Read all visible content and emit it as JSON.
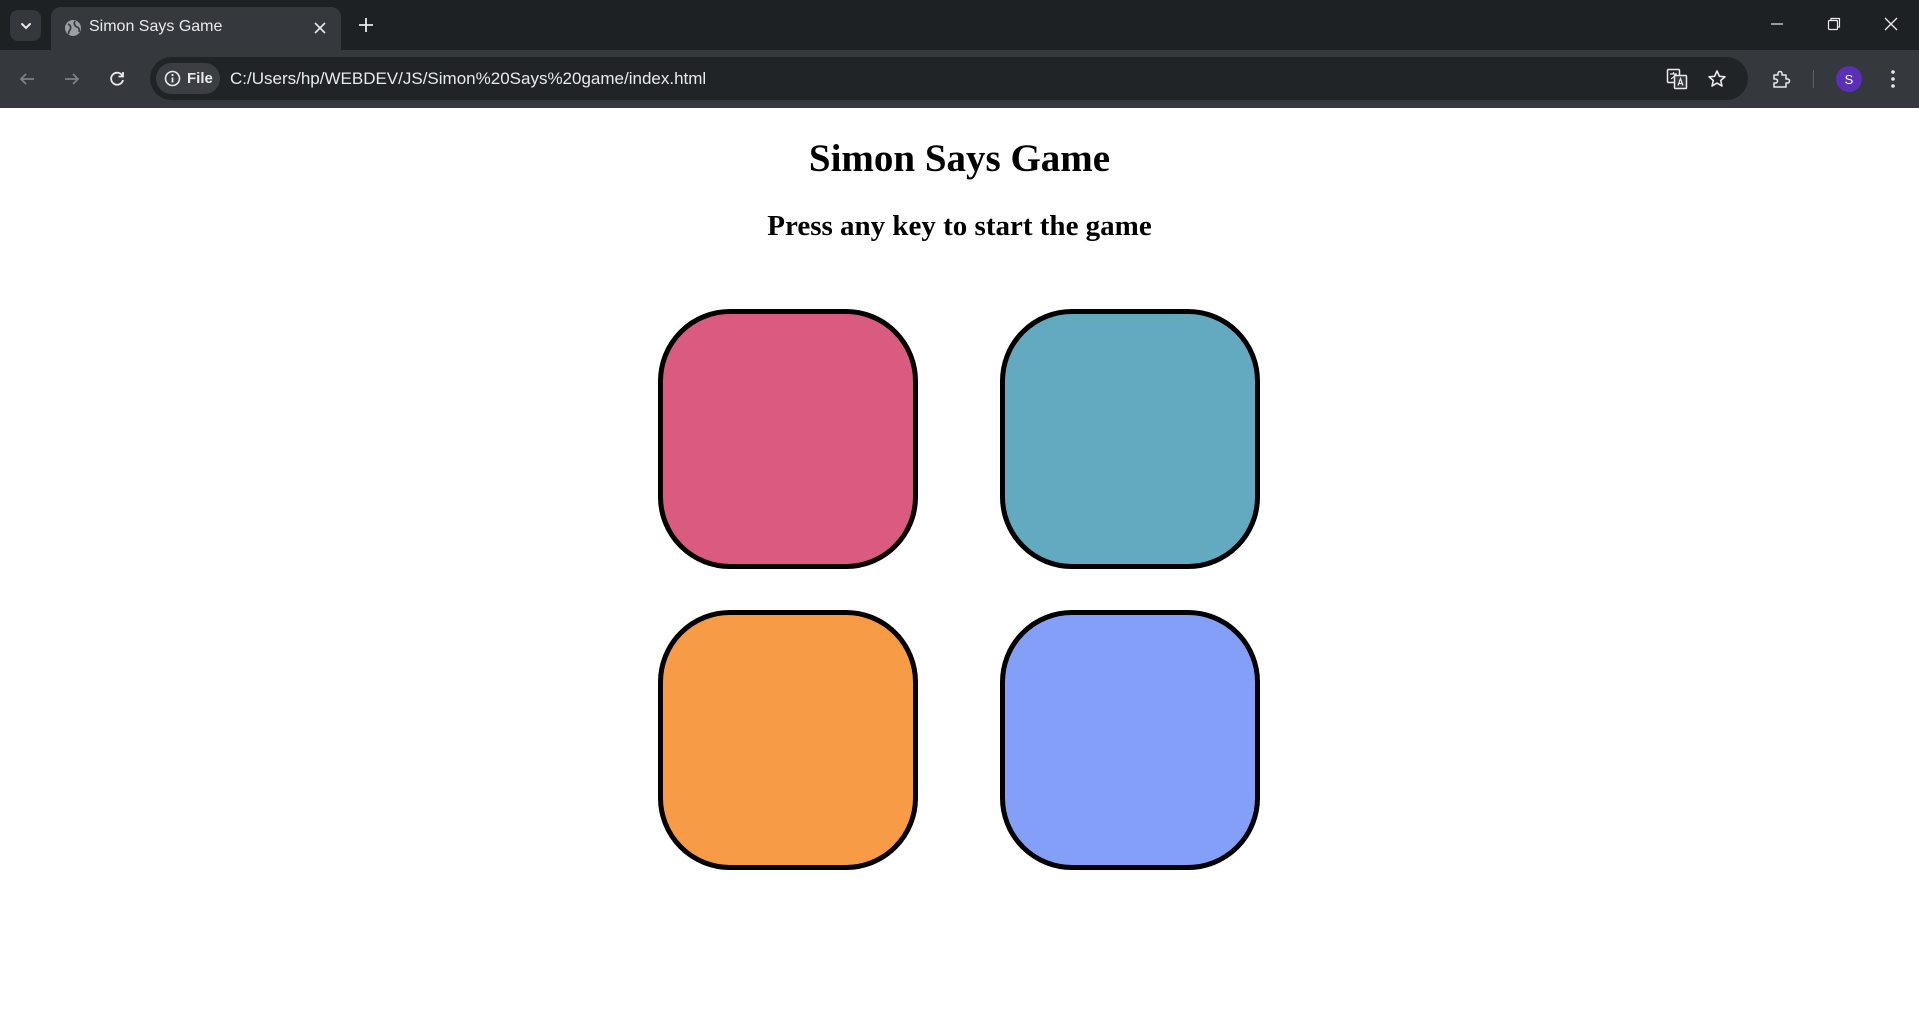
{
  "browser": {
    "tab": {
      "title": "Simon Says Game",
      "favicon": "globe-icon"
    },
    "address_bar": {
      "chip_label": "File",
      "url": "C:/Users/hp/WEBDEV/JS/Simon%20Says%20game/index.html"
    },
    "profile_initial": "S",
    "colors": {
      "tabstrip": "#1e2124",
      "toolbar": "#35393d",
      "avatar": "#5b2fb8"
    }
  },
  "page": {
    "title": "Simon Says Game",
    "status": "Press any key to start the game",
    "buttons": [
      {
        "id": "red",
        "color": "#da5a80"
      },
      {
        "id": "yellow",
        "color": "#63aac0"
      },
      {
        "id": "green",
        "color": "#f79b47"
      },
      {
        "id": "purple",
        "color": "#839ff8"
      }
    ]
  }
}
